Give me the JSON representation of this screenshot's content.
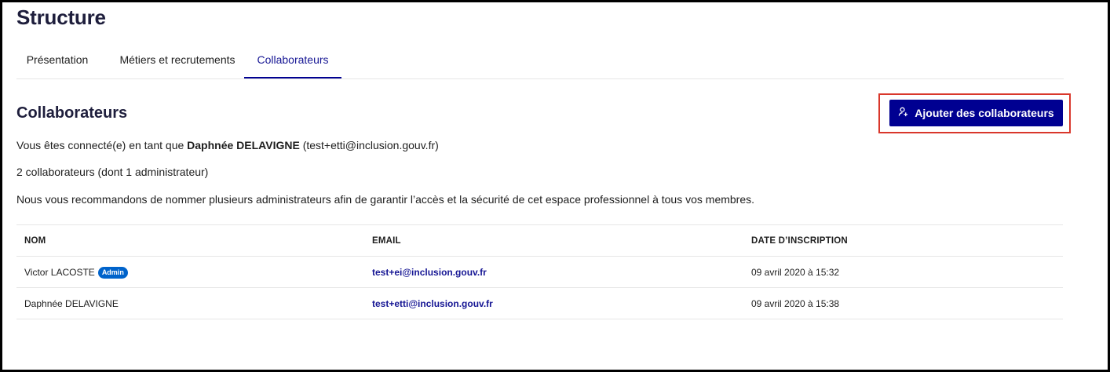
{
  "page_title": "Structure",
  "tabs": [
    {
      "label": "Présentation"
    },
    {
      "label": "Métiers et recrutements"
    },
    {
      "label": "Collaborateurs"
    }
  ],
  "section": {
    "title": "Collaborateurs",
    "add_button_label": "Ajouter des collaborateurs",
    "connected_prefix": "Vous êtes connecté(e) en tant que ",
    "connected_name": "Daphnée DELAVIGNE",
    "connected_email": " (test+etti@inclusion.gouv.fr)",
    "count_text": "2 collaborateurs (dont 1 administrateur)",
    "recommendation": "Nous vous recommandons de nommer plusieurs administrateurs afin de garantir l’accès et la sécurité de cet espace professionnel à tous vos membres."
  },
  "table": {
    "headers": [
      "NOM",
      "EMAIL",
      "DATE D’INSCRIPTION"
    ],
    "rows": [
      {
        "name": "Victor LACOSTE",
        "badge": "Admin",
        "email": "test+ei@inclusion.gouv.fr",
        "date": "09 avril 2020 à 15:32"
      },
      {
        "name": "Daphnée DELAVIGNE",
        "badge": "",
        "email": "test+etti@inclusion.gouv.fr",
        "date": "09 avril 2020 à 15:38"
      }
    ]
  },
  "colors": {
    "primary": "#000091",
    "badge": "#0063cb",
    "highlight": "#d9372b"
  },
  "icons": {
    "add_button": "user-add-icon"
  }
}
